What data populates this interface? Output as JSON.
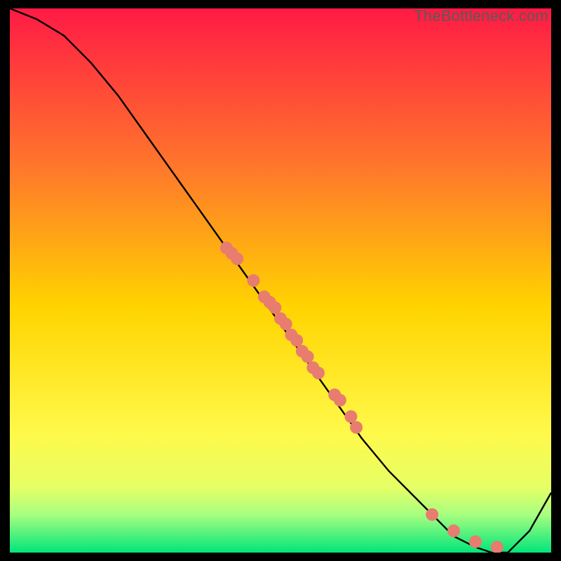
{
  "watermark": "TheBottleneck.com",
  "colors": {
    "gradient_top": "#ff1a45",
    "gradient_mid_upper": "#ff7a2a",
    "gradient_mid": "#ffd400",
    "gradient_mid_lower": "#fff94a",
    "gradient_low1": "#e6ff66",
    "gradient_low2": "#a8ff80",
    "gradient_bottom": "#00e57a",
    "curve": "#000000",
    "points_fill": "#e87c6f",
    "points_stroke": "#d85a4a"
  },
  "chart_data": {
    "type": "line",
    "title": "",
    "xlabel": "",
    "ylabel": "",
    "xlim": [
      0,
      100
    ],
    "ylim": [
      0,
      100
    ],
    "curve": {
      "x": [
        0,
        5,
        10,
        15,
        20,
        25,
        30,
        35,
        40,
        45,
        50,
        55,
        60,
        65,
        70,
        75,
        80,
        82,
        86,
        89,
        92,
        96,
        100
      ],
      "y": [
        100,
        98,
        95,
        90,
        84,
        77,
        70,
        63,
        56,
        49,
        42,
        35,
        28,
        21,
        15,
        10,
        5,
        3,
        1,
        0,
        0,
        4,
        11
      ]
    },
    "points": [
      {
        "x": 40,
        "y": 56
      },
      {
        "x": 41,
        "y": 55
      },
      {
        "x": 42,
        "y": 54
      },
      {
        "x": 45,
        "y": 50
      },
      {
        "x": 47,
        "y": 47
      },
      {
        "x": 48,
        "y": 46
      },
      {
        "x": 49,
        "y": 45
      },
      {
        "x": 50,
        "y": 43
      },
      {
        "x": 51,
        "y": 42
      },
      {
        "x": 52,
        "y": 40
      },
      {
        "x": 53,
        "y": 39
      },
      {
        "x": 54,
        "y": 37
      },
      {
        "x": 55,
        "y": 36
      },
      {
        "x": 56,
        "y": 34
      },
      {
        "x": 57,
        "y": 33
      },
      {
        "x": 60,
        "y": 29
      },
      {
        "x": 61,
        "y": 28
      },
      {
        "x": 63,
        "y": 25
      },
      {
        "x": 64,
        "y": 23
      },
      {
        "x": 78,
        "y": 7
      },
      {
        "x": 82,
        "y": 4
      },
      {
        "x": 86,
        "y": 2
      },
      {
        "x": 90,
        "y": 1
      }
    ]
  }
}
